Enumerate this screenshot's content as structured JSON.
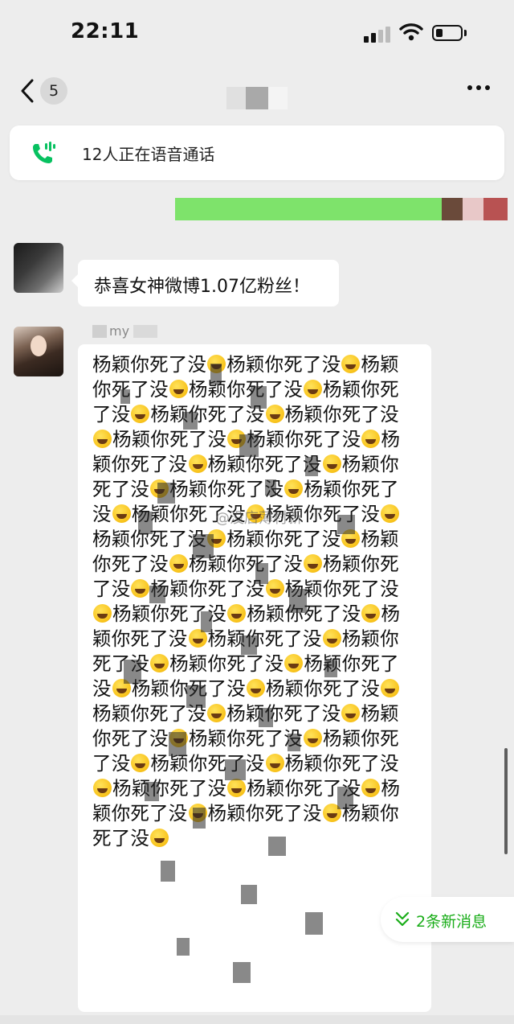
{
  "status_bar": {
    "time": "22:11",
    "icons": [
      "signal-icon",
      "wifi-icon",
      "battery-icon"
    ]
  },
  "nav": {
    "back_icon": "chevron-left-icon",
    "unread_count": "5",
    "more_icon": "more-dots-icon"
  },
  "voice_banner": {
    "icon": "voice-call-icon",
    "text": "12人正在语音通话",
    "accent_color": "#07c160"
  },
  "messages": [
    {
      "avatar": "avatar-dark",
      "text": "恭喜女神微博1.07亿粉丝！"
    },
    {
      "avatar": "avatar-girl",
      "sender_name": "my",
      "text_segment": "杨颖你死了没",
      "segment_emoji": "rolling-laugh-emoji"
    }
  ],
  "watermark": "@没店薄村新",
  "new_messages": {
    "icon": "double-chevron-down-icon",
    "label": "2条新消息",
    "color": "#1aad19"
  }
}
